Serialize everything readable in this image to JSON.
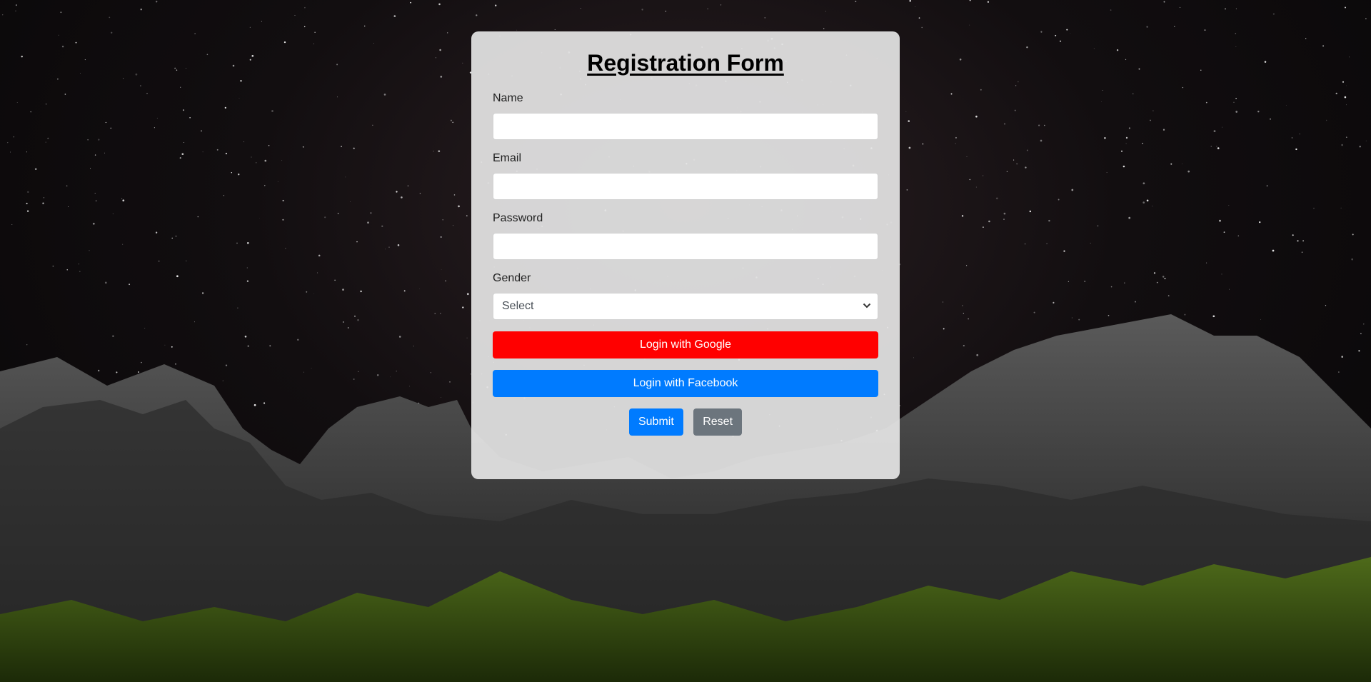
{
  "form": {
    "title": "Registration Form",
    "name_label": "Name",
    "name_value": "",
    "email_label": "Email",
    "email_value": "",
    "password_label": "Password",
    "password_value": "",
    "gender_label": "Gender",
    "gender_selected": "Select",
    "google_label": "Login with Google",
    "facebook_label": "Login with Facebook",
    "submit_label": "Submit",
    "reset_label": "Reset"
  },
  "colors": {
    "google": "#ff0000",
    "facebook": "#007bff",
    "submit": "#007bff",
    "reset": "#6c757d",
    "card": "#e4e4e4"
  },
  "icons": {
    "select_arrow": "chevron-down-icon"
  }
}
